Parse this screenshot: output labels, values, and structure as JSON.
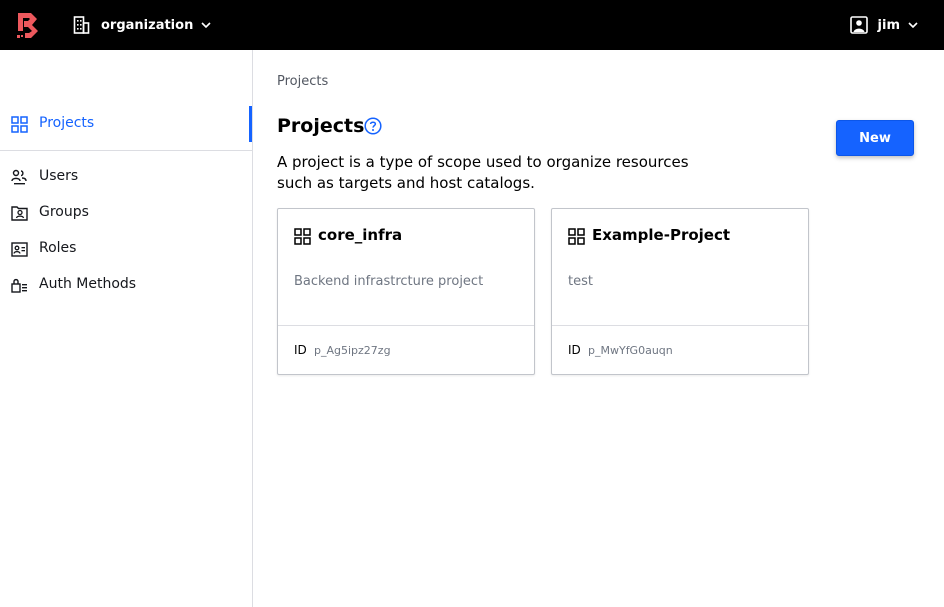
{
  "header": {
    "org_label": "organization",
    "user_label": "jim"
  },
  "sidebar": {
    "items": [
      {
        "label": "Projects",
        "icon": "grid-icon",
        "active": true
      },
      {
        "label": "Users",
        "icon": "users-icon"
      },
      {
        "label": "Groups",
        "icon": "folder-users-icon"
      },
      {
        "label": "Roles",
        "icon": "id-card-icon"
      },
      {
        "label": "Auth Methods",
        "icon": "lock-list-icon"
      }
    ]
  },
  "main": {
    "breadcrumb": "Projects",
    "title": "Projects",
    "description": "A project is a type of scope used to organize resources such as targets and host catalogs.",
    "new_button": "New",
    "id_key": "ID",
    "cards": [
      {
        "name": "core_infra",
        "description": "Backend infrastrcture project",
        "id": "p_Ag5ipz27zg"
      },
      {
        "name": "Example-Project",
        "description": "test",
        "id": "p_MwYfG0auqn"
      }
    ]
  },
  "colors": {
    "accent": "#1563ff",
    "brand": "#ec585d",
    "topbar": "#000000"
  }
}
